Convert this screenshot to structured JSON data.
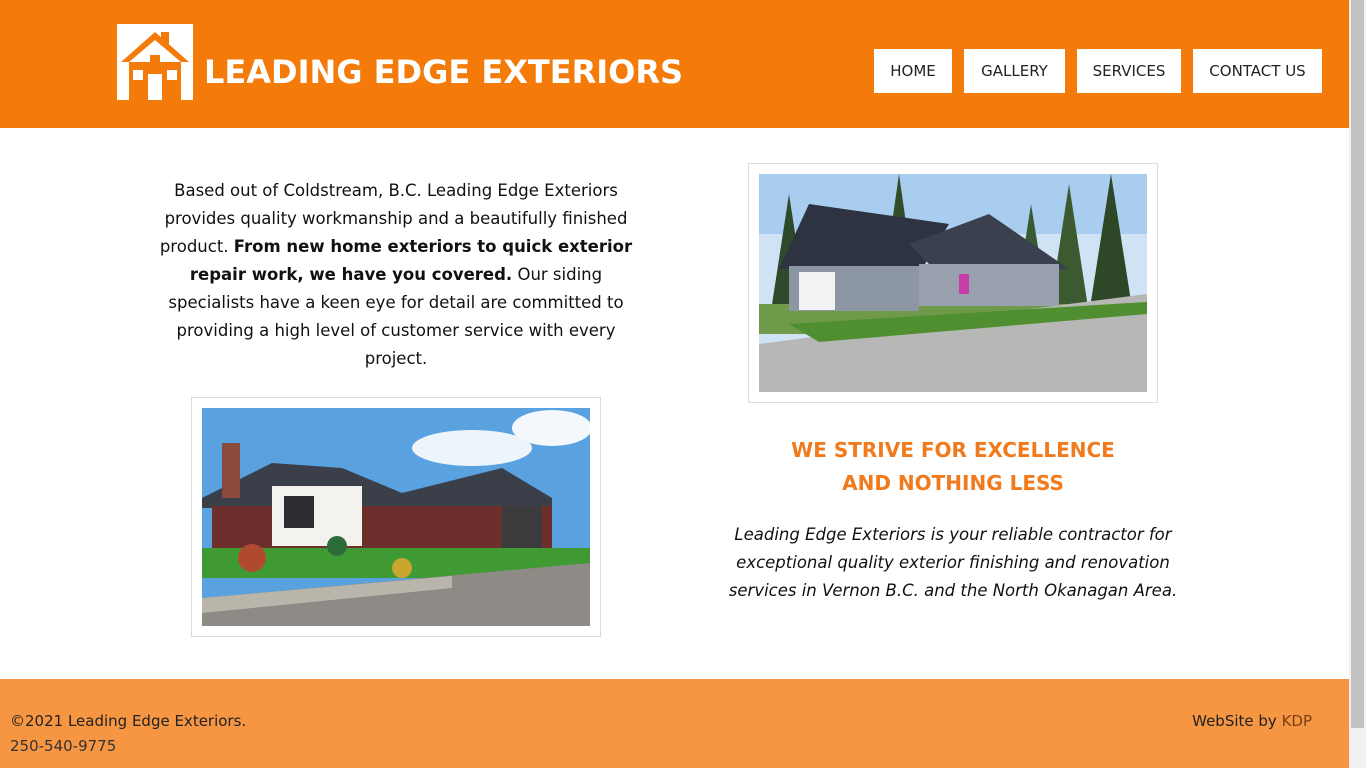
{
  "brand": {
    "name": "LEADING EDGE EXTERIORS",
    "logo_icon": "house-logo-icon",
    "primary_color": "#f47a0a",
    "footer_color": "#f69642",
    "heading_color": "#f07a1c"
  },
  "nav": {
    "items": [
      {
        "label": "HOME"
      },
      {
        "label": "GALLERY"
      },
      {
        "label": "SERVICES"
      },
      {
        "label": "CONTACT US"
      }
    ]
  },
  "intro": {
    "part1": "Based out of Coldstream, B.C. Leading Edge Exteriors provides quality workmanship and a beautifully finished product. ",
    "bold": "From new home exteriors to quick exterior repair work, we have you covered.",
    "part2": " Our siding specialists have a keen eye for detail are committed to providing a high level of customer service with every project."
  },
  "slogan": {
    "line1": "WE STRIVE FOR EXCELLENCE",
    "line2": "AND NOTHING LESS"
  },
  "tagline": "Leading Edge Exteriors is your reliable contractor for exceptional quality exterior finishing and renovation services in Vernon B.C. and the North Okanagan Area.",
  "footer": {
    "copyright": "©2021 Leading Edge Exteriors.",
    "phone": "250-540-9775",
    "credit_prefix": "WebSite by ",
    "credit_link": "KDP"
  }
}
